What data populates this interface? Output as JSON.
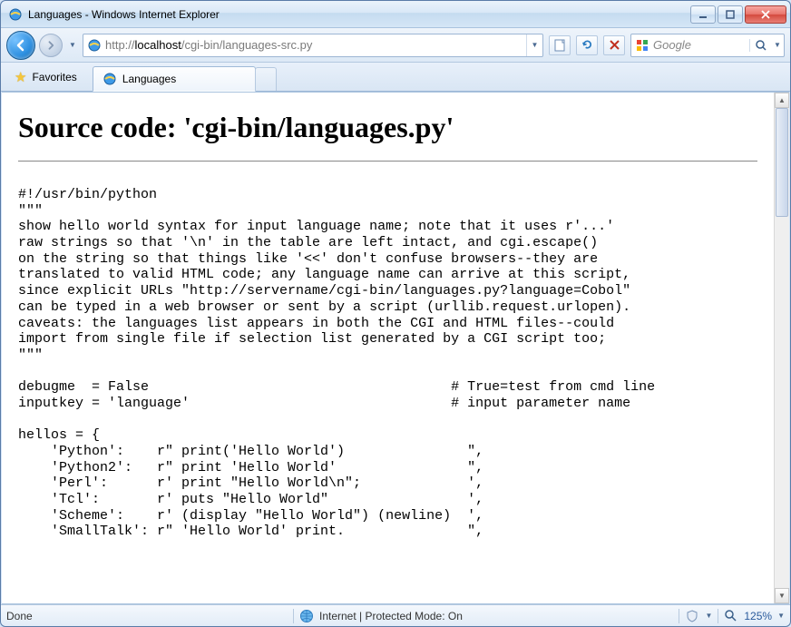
{
  "window": {
    "title": "Languages - Windows Internet Explorer"
  },
  "nav": {
    "url_prefix": "http://",
    "url_host": "localhost",
    "url_path": "/cgi-bin/languages-src.py",
    "search_placeholder": "Google"
  },
  "favorites": {
    "label": "Favorites"
  },
  "tab": {
    "title": "Languages"
  },
  "content": {
    "heading": "Source code: 'cgi-bin/languages.py'",
    "code": "#!/usr/bin/python\n\"\"\"\nshow hello world syntax for input language name; note that it uses r'...'\nraw strings so that '\\n' in the table are left intact, and cgi.escape()\non the string so that things like '<<' don't confuse browsers--they are\ntranslated to valid HTML code; any language name can arrive at this script,\nsince explicit URLs \"http://servername/cgi-bin/languages.py?language=Cobol\"\ncan be typed in a web browser or sent by a script (urllib.request.urlopen).\ncaveats: the languages list appears in both the CGI and HTML files--could\nimport from single file if selection list generated by a CGI script too;\n\"\"\"\n\ndebugme  = False                                     # True=test from cmd line\ninputkey = 'language'                                # input parameter name\n\nhellos = {\n    'Python':    r\" print('Hello World')               \",\n    'Python2':   r\" print 'Hello World'                \",\n    'Perl':      r' print \"Hello World\\n\";             ',\n    'Tcl':       r' puts \"Hello World\"                 ',\n    'Scheme':    r' (display \"Hello World\") (newline)  ',\n    'SmallTalk': r\" 'Hello World' print.               \","
  },
  "status": {
    "left": "Done",
    "zone": "Internet | Protected Mode: On",
    "zoom": "125%"
  }
}
